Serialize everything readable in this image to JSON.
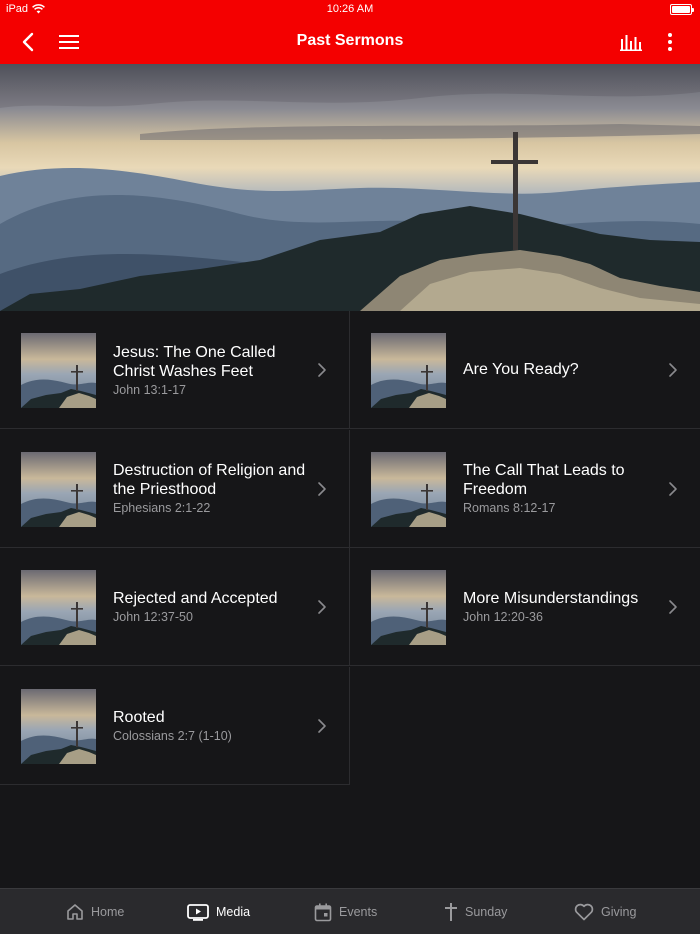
{
  "status_bar": {
    "carrier": "iPad",
    "time": "10:26 AM"
  },
  "nav": {
    "title": "Past Sermons",
    "icons": [
      "back-arrow-icon",
      "hamburger-menu-icon",
      "audio-bars-icon",
      "more-vertical-icon"
    ]
  },
  "colors": {
    "brand": "#f40000",
    "background": "#161618",
    "tab_bar": "#2a2a2d",
    "secondary_text": "#9a9a9d"
  },
  "sermons": [
    {
      "title": "Jesus: The One Called Christ Washes Feet",
      "reference": "John 13:1-17"
    },
    {
      "title": "Are You Ready?",
      "reference": ""
    },
    {
      "title": "Destruction of Religion and the Priesthood",
      "reference": "Ephesians 2:1-22"
    },
    {
      "title": "The Call That Leads to Freedom",
      "reference": "Romans 8:12-17"
    },
    {
      "title": "Rejected and Accepted",
      "reference": "John 12:37-50"
    },
    {
      "title": "More Misunderstandings",
      "reference": "John 12:20-36"
    },
    {
      "title": "Rooted",
      "reference": "Colossians 2:7 (1-10)"
    }
  ],
  "tabs": [
    {
      "label": "Home",
      "icon": "home-icon",
      "active": false
    },
    {
      "label": "Media",
      "icon": "media-player-icon",
      "active": true
    },
    {
      "label": "Events",
      "icon": "calendar-icon",
      "active": false
    },
    {
      "label": "Sunday",
      "icon": "cross-icon",
      "active": false
    },
    {
      "label": "Giving",
      "icon": "heart-icon",
      "active": false
    }
  ]
}
